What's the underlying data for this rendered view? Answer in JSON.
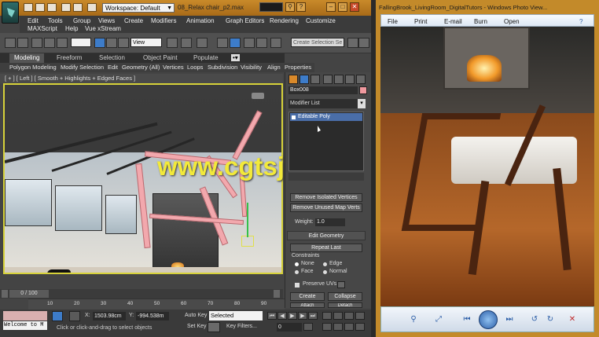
{
  "max": {
    "workspace": "Workspace: Default",
    "filename": "08_Relax chair_p2.max",
    "menus": [
      "Edit",
      "Tools",
      "Group",
      "Views",
      "Create",
      "Modifiers",
      "Animation",
      "Graph Editors",
      "Rendering",
      "Customize",
      "MAXScript",
      "Help",
      "Vue xStream"
    ],
    "view_dropdown": "View",
    "selection_set_placeholder": "Create Selection Se",
    "ribbon_tabs": [
      "Modeling",
      "Freeform",
      "Selection",
      "Object Paint",
      "Populate"
    ],
    "ribbon_sub": [
      "Polygon Modeling",
      "Modify Selection",
      "Edit",
      "Geometry (All)",
      "Vertices",
      "Loops",
      "Subdivision",
      "Visibility",
      "Align",
      "Properties"
    ],
    "viewport_label": "[ + ] [ Left ] [ Smooth + Highlights + Edged Faces ]",
    "watermark": "www.cgtsj.com",
    "object_name": "Box008",
    "modifier_list": "Modifier List",
    "stack_item": "Editable Poly",
    "buttons": {
      "remove_isolated": "Remove Isolated Vertices",
      "remove_unused": "Remove Unused Map Verts",
      "edit_geometry": "Edit Geometry",
      "repeat_last": "Repeat Last",
      "create": "Create",
      "collapse": "Collapse",
      "attach": "Attach",
      "detach": "Detach"
    },
    "weight_label": "Weight:",
    "weight_value": "1.0",
    "constraints_label": "Constraints",
    "constraints": [
      "None",
      "Edge",
      "Face",
      "Normal"
    ],
    "preserve_uvs": "Preserve UVs",
    "timeline_counter": "0 / 100",
    "ruler_ticks": [
      "10",
      "20",
      "30",
      "40",
      "50",
      "60",
      "70",
      "80",
      "90"
    ],
    "listener": "Welcome to M",
    "x_label": "X:",
    "x_value": "1503.98cm",
    "y_label": "Y:",
    "y_value": "-994.538m",
    "auto_key": "Auto Key",
    "set_key": "Set Key",
    "selected": "Selected",
    "key_filters": "Key Filters...",
    "frame_value": "0",
    "status_text": "Click or click-and-drag to select objects"
  },
  "photo_viewer": {
    "title": "FallingBrook_LivingRoom_DigitalTutors - Windows Photo View...",
    "menus": [
      "File",
      "Print",
      "E-mail",
      "Burn",
      "Open"
    ]
  },
  "colors": {
    "max_title": "#b97a20",
    "selection_pink": "#f2a8ad",
    "viewport_border": "#d7d23a",
    "watermark": "#f2e93a",
    "pv_frame": "#c38a2a"
  }
}
